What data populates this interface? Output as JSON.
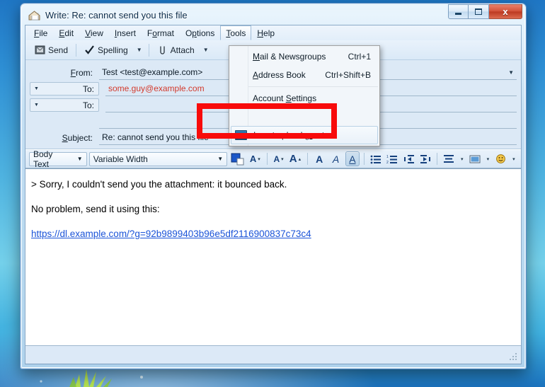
{
  "window": {
    "title": "Write: Re: cannot send you this file",
    "icon": "compose-mail-icon",
    "controls": {
      "minimize": "Minimize",
      "maximize": "Maximize",
      "close": "Close",
      "close_glyph": "x"
    }
  },
  "menubar": {
    "items": [
      {
        "label": "File",
        "accel": "F",
        "active": false
      },
      {
        "label": "Edit",
        "accel": "E",
        "active": false
      },
      {
        "label": "View",
        "accel": "V",
        "active": false
      },
      {
        "label": "Insert",
        "accel": "I",
        "active": false
      },
      {
        "label": "Format",
        "accel": "o",
        "active": false
      },
      {
        "label": "Options",
        "accel": "p",
        "active": false
      },
      {
        "label": "Tools",
        "accel": "T",
        "active": true
      },
      {
        "label": "Help",
        "accel": "H",
        "active": false
      }
    ]
  },
  "toolbar": {
    "send_label": "Send",
    "spelling_label": "Spelling",
    "attach_label": "Attach",
    "dropdown_glyph": "▼"
  },
  "tools_menu": {
    "items": [
      {
        "label": "Mail & Newsgroups",
        "shortcut": "Ctrl+1",
        "icon": ""
      },
      {
        "label": "Address Book",
        "shortcut": "Ctrl+Shift+B",
        "icon": ""
      },
      {
        "label": "Account Settings",
        "shortcut": "",
        "icon": ""
      }
    ],
    "highlighted_item": {
      "label": "Insert upload grant",
      "shortcut": "",
      "icon": "upload-grant-icon"
    }
  },
  "headers": {
    "from_label": "From:",
    "from_value": "Test <test@example.com>",
    "from_dropdown_glyph": "▼",
    "to_label_1": "To:",
    "to_value_1": "some.guy@example.com",
    "to_label_2": "To:",
    "to_value_2": "",
    "recipient_type_glyph": "▼",
    "subject_label": "Subject:",
    "subject_value": "Re: cannot send you this file"
  },
  "format_toolbar": {
    "paragraph_style": "Body Text",
    "font_family": "Variable Width",
    "text_color_swatch": "#1a56c8",
    "buttons": [
      {
        "name": "decrease-font-size",
        "glyph": "A"
      },
      {
        "name": "increase-font-size",
        "glyph": "A"
      },
      {
        "name": "bold",
        "glyph": "A"
      },
      {
        "name": "italic",
        "glyph": "A"
      },
      {
        "name": "underline",
        "glyph": "A"
      },
      {
        "name": "bullet-list",
        "glyph": "≡"
      },
      {
        "name": "numbered-list",
        "glyph": "≡"
      },
      {
        "name": "outdent",
        "glyph": "←"
      },
      {
        "name": "indent",
        "glyph": "→"
      },
      {
        "name": "align",
        "glyph": "≡"
      },
      {
        "name": "insert-image",
        "glyph": "■"
      },
      {
        "name": "insert-smiley",
        "glyph": "☺"
      }
    ],
    "dropdown_glyph": "▼"
  },
  "message_body": {
    "quoted_line": "> Sorry, I couldn't send you the attachment: it bounced back.",
    "reply_line": "No problem, send it using this:",
    "link": "https://dl.example.com/?g=92b9899403b96e5df2116900837c73c4"
  },
  "statusbar": {
    "text": ""
  },
  "annotation": {
    "type": "red-highlight-box",
    "target": "Insert upload grant"
  }
}
